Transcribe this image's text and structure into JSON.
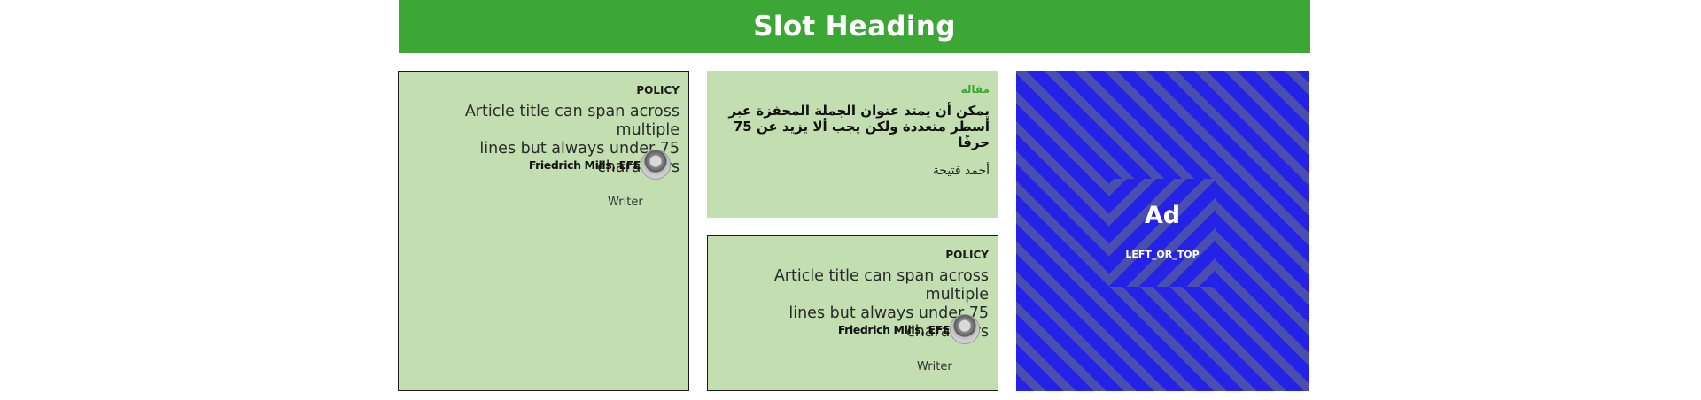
{
  "slot": {
    "heading": "Slot Heading"
  },
  "cards": [
    {
      "kicker": "POLICY",
      "title_line1": "Article title can span across multiple",
      "title_line2": "lines but always under 75 characters",
      "author": "Friedrich Mills, EFE",
      "role": "Writer"
    },
    {
      "kicker": "مقالة",
      "title_line1": "يمكن أن يمتد عنوان الجملة المحفزة عبر",
      "title_line2": "أسطر متعددة ولكن يجب ألا يزيد عن 75",
      "title_line3": "حرفًا",
      "author": "أحمد فتيحة"
    },
    {
      "kicker": "POLICY",
      "title_line1": "Article title can span across multiple",
      "title_line2": "lines but always under 75 characters",
      "author": "Friedrich Mills, EFE",
      "role": "Writer"
    }
  ],
  "ad": {
    "label": "Ad",
    "position": "LEFT_OR_TOP"
  },
  "colors": {
    "brand_green": "#3da736",
    "card_bg": "#c3deb0",
    "ad_blue": "#2322e6"
  }
}
